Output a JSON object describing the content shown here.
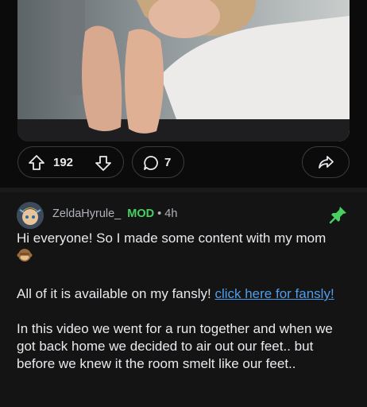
{
  "post": {
    "upvote_count": "192",
    "comment_count": "7"
  },
  "comment": {
    "author": "ZeldaHyrule_",
    "role_badge": "MOD",
    "separator": "•",
    "age": "4h",
    "paragraph1": "Hi everyone! So I made some content with my mom",
    "paragraph2_prefix": "All of it is available on my fansly! ",
    "link_text": "click here for fansly!",
    "paragraph3": "In this video we went for a run together and when we got back home we decided to air out our feet.. but before we knew it the room smelt like our feet.."
  },
  "colors": {
    "background": "#0b0b0c",
    "comment_bg": "#141415",
    "mod_green": "#46d160",
    "link_blue": "#4f9dea",
    "pill_border": "#3a3c3f"
  },
  "icons": [
    "upvote-icon",
    "downvote-icon",
    "comment-icon",
    "share-icon",
    "pin-icon",
    "monkey-emoji-icon"
  ]
}
